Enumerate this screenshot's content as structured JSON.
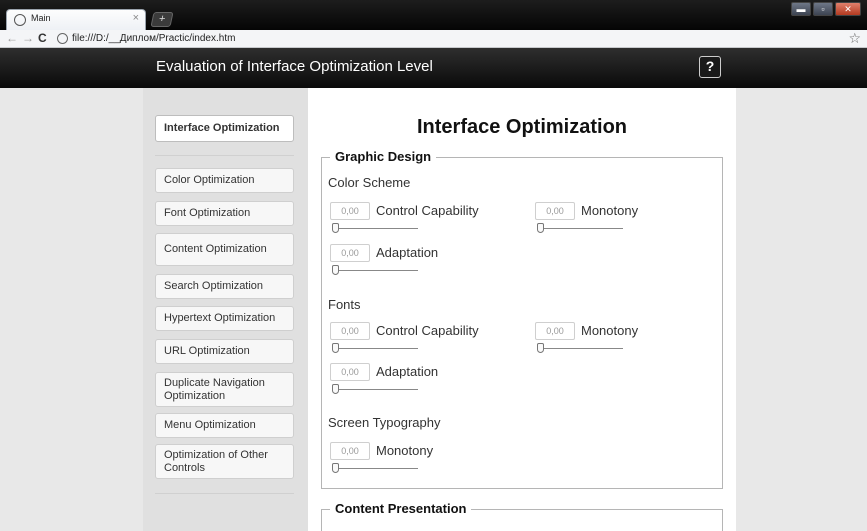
{
  "browser": {
    "tab_title": "Main",
    "tab_close": "×",
    "new_tab": "+",
    "url": "file:///D:/__Диплом/Practic/index.htm",
    "nav_back": "←",
    "nav_forward": "→",
    "nav_reload": "C",
    "star": "☆",
    "window_controls": {
      "minimize": "▬",
      "maximize": "▫",
      "close": "✕"
    }
  },
  "header": {
    "title": "Evaluation of Interface Optimization Level",
    "help_label": "?"
  },
  "sidebar": {
    "items": [
      {
        "label": "Interface Optimization",
        "active": true
      },
      {
        "label": "Color Optimization"
      },
      {
        "label": "Font Optimization"
      },
      {
        "label": "Content Optimization"
      },
      {
        "label": "Search Optimization"
      },
      {
        "label": "Hypertext Optimization"
      },
      {
        "label": "URL Optimization"
      },
      {
        "label": "Duplicate Navigation Optimization"
      },
      {
        "label": "Menu Optimization"
      },
      {
        "label": "Optimization of Other Controls"
      }
    ]
  },
  "main": {
    "title": "Interface Optimization",
    "graphic_design": {
      "legend": "Graphic Design",
      "color_scheme": {
        "heading": "Color Scheme",
        "control_capability": {
          "value": "0,00",
          "label": "Control Capability"
        },
        "monotony": {
          "value": "0,00",
          "label": "Monotony"
        },
        "adaptation": {
          "value": "0,00",
          "label": "Adaptation"
        }
      },
      "fonts": {
        "heading": "Fonts",
        "control_capability": {
          "value": "0,00",
          "label": "Control Capability"
        },
        "monotony": {
          "value": "0,00",
          "label": "Monotony"
        },
        "adaptation": {
          "value": "0,00",
          "label": "Adaptation"
        }
      },
      "screen_typography": {
        "heading": "Screen Typography",
        "monotony": {
          "value": "0,00",
          "label": "Monotony"
        }
      }
    },
    "content_presentation": {
      "legend": "Content Presentation"
    }
  },
  "colors": {
    "header_bg": "#111111",
    "sidebar_bg": "#e0e0e0",
    "page_bg": "#e8e8e8",
    "content_bg": "#ffffff"
  }
}
